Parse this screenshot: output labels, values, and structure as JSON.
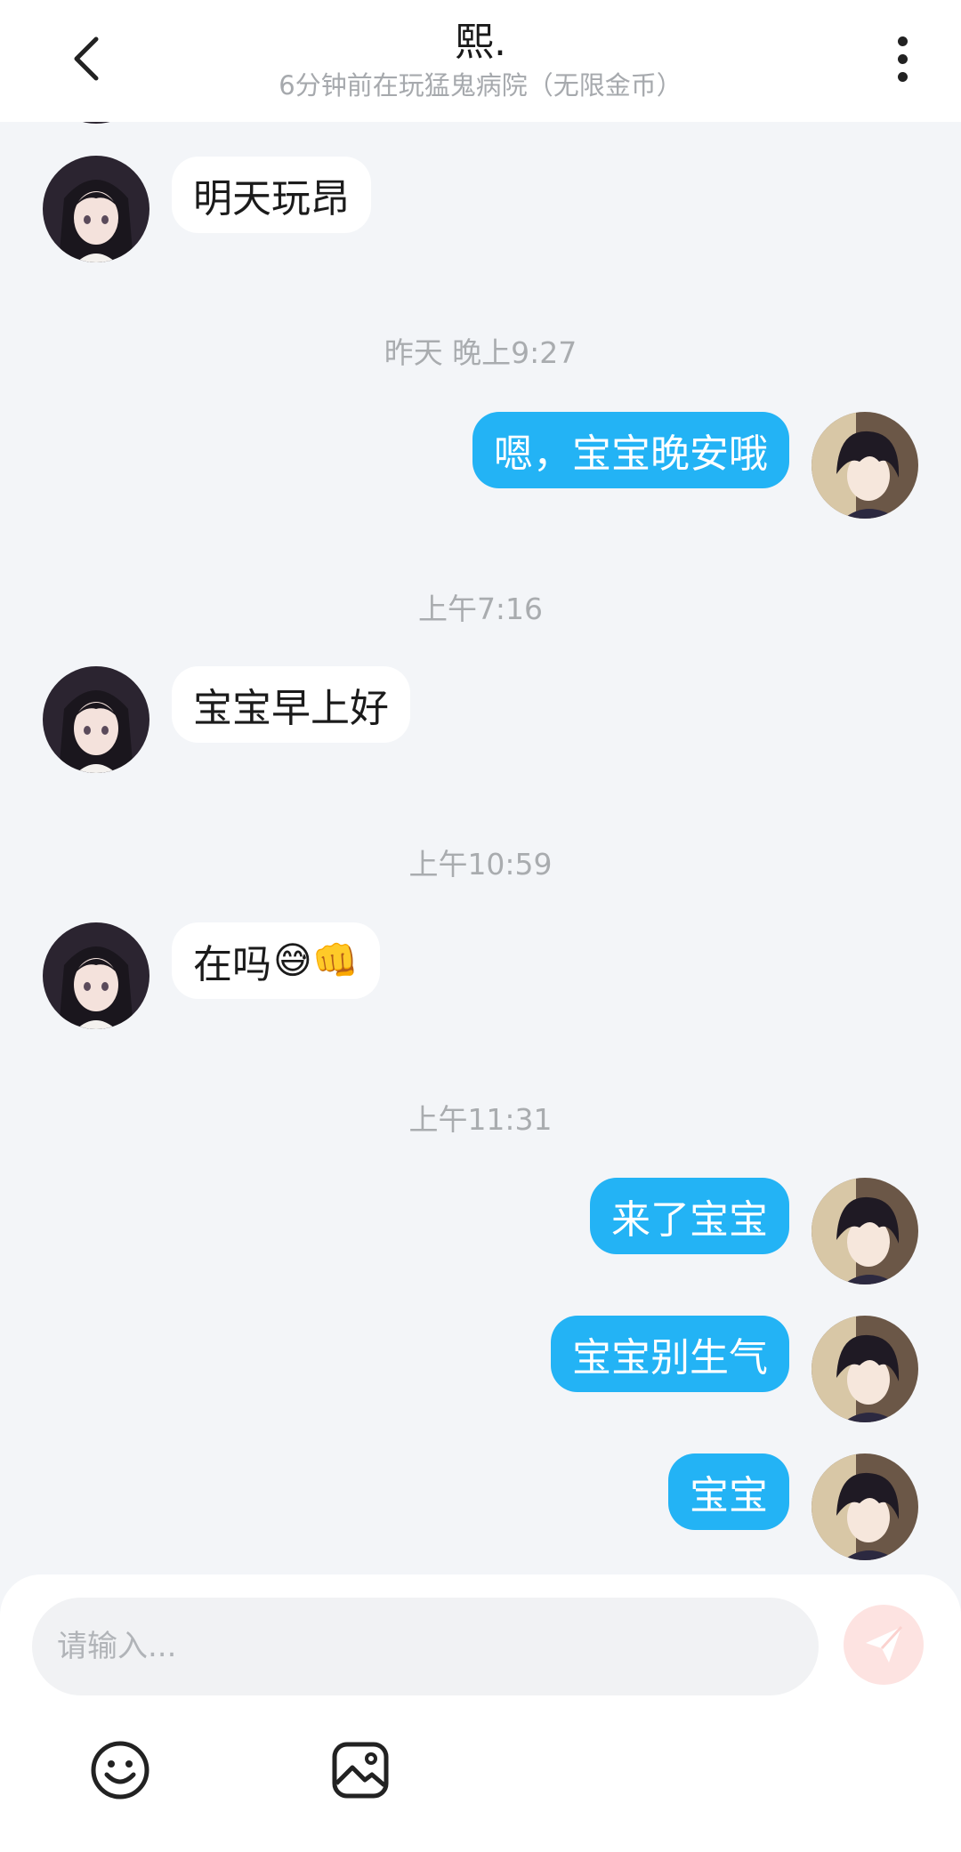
{
  "header": {
    "title": "熙.",
    "subtitle": "6分钟前在玩猛鬼病院（无限金币）"
  },
  "messages": [
    {
      "side": "in",
      "text": "明天玩昂"
    },
    {
      "type": "time",
      "text": "昨天 晚上9:27"
    },
    {
      "side": "out",
      "text": "嗯，宝宝晚安哦"
    },
    {
      "type": "time",
      "text": "上午7:16"
    },
    {
      "side": "in",
      "text": "宝宝早上好"
    },
    {
      "type": "time",
      "text": "上午10:59"
    },
    {
      "side": "in",
      "text": "在吗",
      "emojis": "😅👊"
    },
    {
      "type": "time",
      "text": "上午11:31"
    },
    {
      "side": "out",
      "text": "来了宝宝"
    },
    {
      "side": "out",
      "text": "宝宝别生气"
    },
    {
      "side": "out",
      "text": "宝宝"
    }
  ],
  "composer": {
    "placeholder": "请输入...",
    "send_color": "#fde3e1"
  },
  "colors": {
    "outgoing_bubble": "#23b3f5",
    "incoming_bubble": "#ffffff",
    "background": "#f3f5f8"
  }
}
